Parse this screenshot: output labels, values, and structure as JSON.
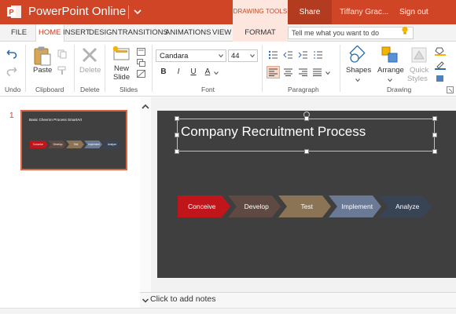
{
  "app": {
    "name": "PowerPoint Online",
    "context_tab": "DRAWING TOOLS",
    "share_label": "Share",
    "user_name": "Tiffany Grac...",
    "signout_label": "Sign out",
    "brand_color": "#d04526"
  },
  "tabs": [
    {
      "label": "FILE"
    },
    {
      "label": "HOME",
      "active": true
    },
    {
      "label": "INSERT"
    },
    {
      "label": "DESIGN"
    },
    {
      "label": "TRANSITIONS"
    },
    {
      "label": "ANIMATIONS"
    },
    {
      "label": "VIEW"
    },
    {
      "label": "FORMAT"
    }
  ],
  "tell_me": {
    "placeholder": "Tell me what you want to do"
  },
  "ribbon": {
    "undo_group": "Undo",
    "clipboard": {
      "paste": "Paste",
      "group": "Clipboard"
    },
    "delete": {
      "label": "Delete",
      "group": "Delete"
    },
    "slides": {
      "new_slide_line1": "New",
      "new_slide_line2": "Slide",
      "group": "Slides"
    },
    "font": {
      "family": "Candara",
      "size": "44",
      "bold": "B",
      "italic": "I",
      "underline": "U",
      "color": "A",
      "group": "Font"
    },
    "paragraph": {
      "group": "Paragraph"
    },
    "drawing": {
      "shapes": "Shapes",
      "arrange": "Arrange",
      "quick_styles_line1": "Quick",
      "quick_styles_line2": "Styles",
      "group": "Drawing"
    }
  },
  "thumbnail": {
    "number": "1",
    "title": "Basic Chevron Process SmartArt",
    "steps": [
      "Conceive",
      "Develop",
      "Test",
      "Implement",
      "Analyze"
    ]
  },
  "slide": {
    "title": "Company Recruitment Process",
    "background": "#3f3f3f",
    "steps": [
      {
        "label": "Conceive",
        "color": "#c0151b"
      },
      {
        "label": "Develop",
        "color": "#5e4a42"
      },
      {
        "label": "Test",
        "color": "#8b7355"
      },
      {
        "label": "Implement",
        "color": "#6b7a94"
      },
      {
        "label": "Analyze",
        "color": "#384454"
      }
    ]
  },
  "notes": {
    "placeholder": "Click to add notes"
  }
}
